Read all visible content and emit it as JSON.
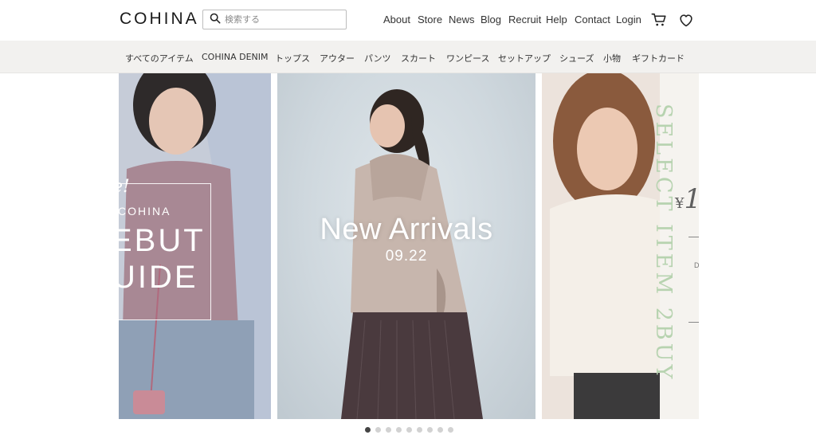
{
  "header": {
    "logo": "COHINA",
    "search_placeholder": "検索する",
    "nav": [
      "About",
      "Store",
      "News",
      "Blog",
      "Recruit",
      "Help",
      "Contact",
      "Login"
    ]
  },
  "categories": [
    "すべてのアイテム",
    "COHINA DENIM",
    "トップス",
    "アウター",
    "パンツ",
    "スカート",
    "ワンピース",
    "セットアップ",
    "シューズ",
    "小物",
    "ギフトカード"
  ],
  "slides": {
    "left": {
      "script": "e!",
      "brand": "COHINA",
      "line1": "EBUT",
      "line2": "UIDE"
    },
    "center": {
      "title": "New Arrivals",
      "date": "09.22"
    },
    "right": {
      "vertical": "SELECT ITEM 2BUY",
      "price_prefix": "¥",
      "price": "1",
      "small": "D"
    }
  },
  "pagination": {
    "count": 9,
    "active": 0
  },
  "colors": {
    "accent_green": "#b7d3b0",
    "category_bar": "#f2f1ef",
    "active_dot": "#444444",
    "inactive_dot": "#d2d2d2"
  },
  "icons": [
    "search-icon",
    "cart-icon",
    "heart-icon"
  ]
}
